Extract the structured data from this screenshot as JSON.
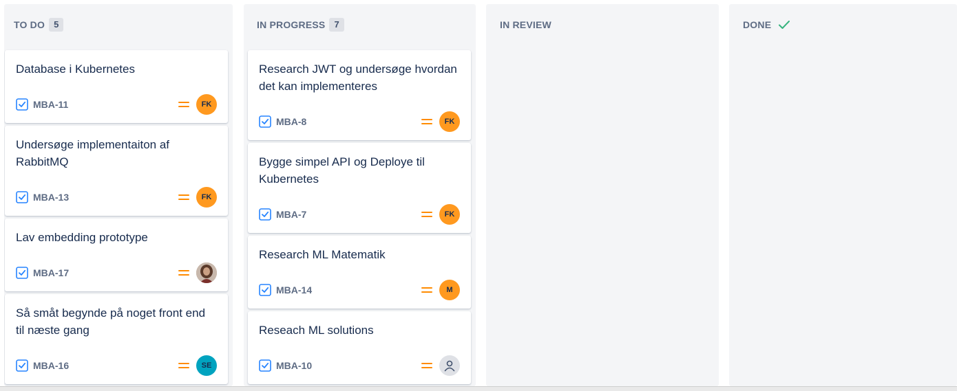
{
  "colors": {
    "avatar_orange": "#ff991f",
    "avatar_teal": "#00a3bf",
    "avatar_gray": "#dfe1e6",
    "priority_orange": "#ff8b00",
    "type_blue": "#2684ff",
    "done_check": "#36b37e"
  },
  "columns": [
    {
      "title": "TO DO",
      "count": "5",
      "cards": [
        {
          "title": "Database i Kubernetes",
          "key": "MBA-11",
          "avatar": "FK"
        },
        {
          "title": "Undersøge implementaiton af RabbitMQ",
          "key": "MBA-13",
          "avatar": "FK"
        },
        {
          "title": "Lav embedding prototype",
          "key": "MBA-17",
          "avatar": "photo"
        },
        {
          "title": "Så småt begynde på noget front end til næste gang",
          "key": "MBA-16",
          "avatar": "SE"
        }
      ]
    },
    {
      "title": "IN PROGRESS",
      "count": "7",
      "cards": [
        {
          "title": "Research JWT og undersøge hvordan det kan implementeres",
          "key": "MBA-8",
          "avatar": "FK"
        },
        {
          "title": "Bygge simpel API og Deploye til Kubernetes",
          "key": "MBA-7",
          "avatar": "FK"
        },
        {
          "title": "Research ML Matematik",
          "key": "MBA-14",
          "avatar": "M"
        },
        {
          "title": "Reseach ML solutions",
          "key": "MBA-10",
          "avatar": "unassigned"
        }
      ]
    },
    {
      "title": "IN REVIEW",
      "cards": []
    },
    {
      "title": "DONE",
      "icon": "check-icon",
      "cards": []
    }
  ],
  "icons": {
    "issue_type": "task-checkbox-icon",
    "priority": "priority-medium-icon",
    "unassigned": "user-icon"
  }
}
